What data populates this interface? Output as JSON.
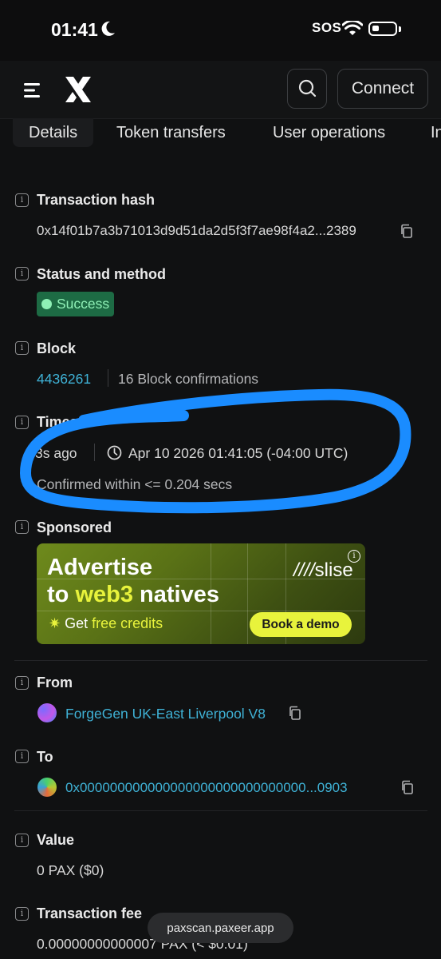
{
  "status_bar": {
    "time": "01:41",
    "sos": "SOS"
  },
  "header": {
    "connect_label": "Connect"
  },
  "tabs": [
    {
      "label": "Details"
    },
    {
      "label": "Token transfers"
    },
    {
      "label": "User operations"
    },
    {
      "label": "In"
    }
  ],
  "details": {
    "tx_hash": {
      "label": "Transaction hash",
      "value": "0x14f01b7a3b71013d9d51da2d5f3f7ae98f4a2...2389"
    },
    "status": {
      "label": "Status and method",
      "badge": "Success"
    },
    "block": {
      "label": "Block",
      "number": "4436261",
      "confirmations": "16 Block confirmations"
    },
    "timestamp": {
      "label": "Timest",
      "ago": "3s ago",
      "datetime": "Apr 10 2026 01:41:05 (-04:00 UTC)",
      "confirmed": "Confirmed within <= 0.204 secs"
    },
    "sponsored": {
      "label": "Sponsored",
      "ad_line1": "Advertise",
      "ad_line2_a": "to ",
      "ad_line2_b": "web3",
      "ad_line2_c": " natives",
      "ad_credits_a": "Get ",
      "ad_credits_b": "free credits",
      "ad_brand": "slise",
      "ad_cta": "Book a demo"
    },
    "from": {
      "label": "From",
      "value": "ForgeGen UK-East Liverpool V8"
    },
    "to": {
      "label": "To",
      "value": "0x000000000000000000000000000000...0903"
    },
    "value": {
      "label": "Value",
      "amount": "0 PAX ($0)"
    },
    "fee": {
      "label": "Transaction fee",
      "amount": "0.00000000000007 PAX (< $0.01)"
    }
  },
  "browser": {
    "url": "paxscan.paxeer.app"
  },
  "colors": {
    "background": "#101112",
    "link": "#3fb2d6",
    "success_bg": "#1d6b44",
    "annotation": "#1a8cff"
  }
}
